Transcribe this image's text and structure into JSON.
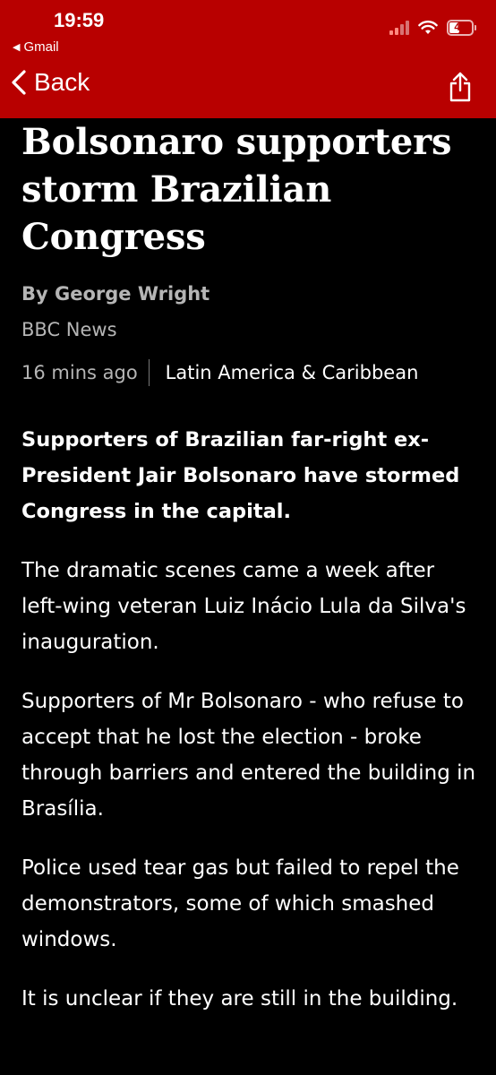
{
  "status_bar": {
    "time": "19:59",
    "back_app": "Gmail",
    "battery": "49",
    "battery_level": 0.49
  },
  "nav": {
    "back_label": "Back"
  },
  "article": {
    "headline": "Bolsonaro supporters storm Brazilian Congress",
    "byline": "By George Wright",
    "source": "BBC News",
    "time": "16 mins ago",
    "category": "Latin America & Caribbean",
    "lead": "Supporters of Brazilian far-right ex-President Jair Bolsonaro have stormed Congress in the capital.",
    "paragraphs": [
      "The dramatic scenes came a week after left-wing veteran Luiz Inácio Lula da Silva's inauguration.",
      "Supporters of Mr Bolsonaro - who refuse to accept that he lost the election - broke through barriers and entered the building in Brasília.",
      "Police used tear gas but failed to repel the demonstrators, some of which smashed windows.",
      "It is unclear if they are still in the building."
    ]
  },
  "colors": {
    "brand_red": "#b80000",
    "background": "#000000",
    "secondary_text": "#b5b5b5"
  }
}
